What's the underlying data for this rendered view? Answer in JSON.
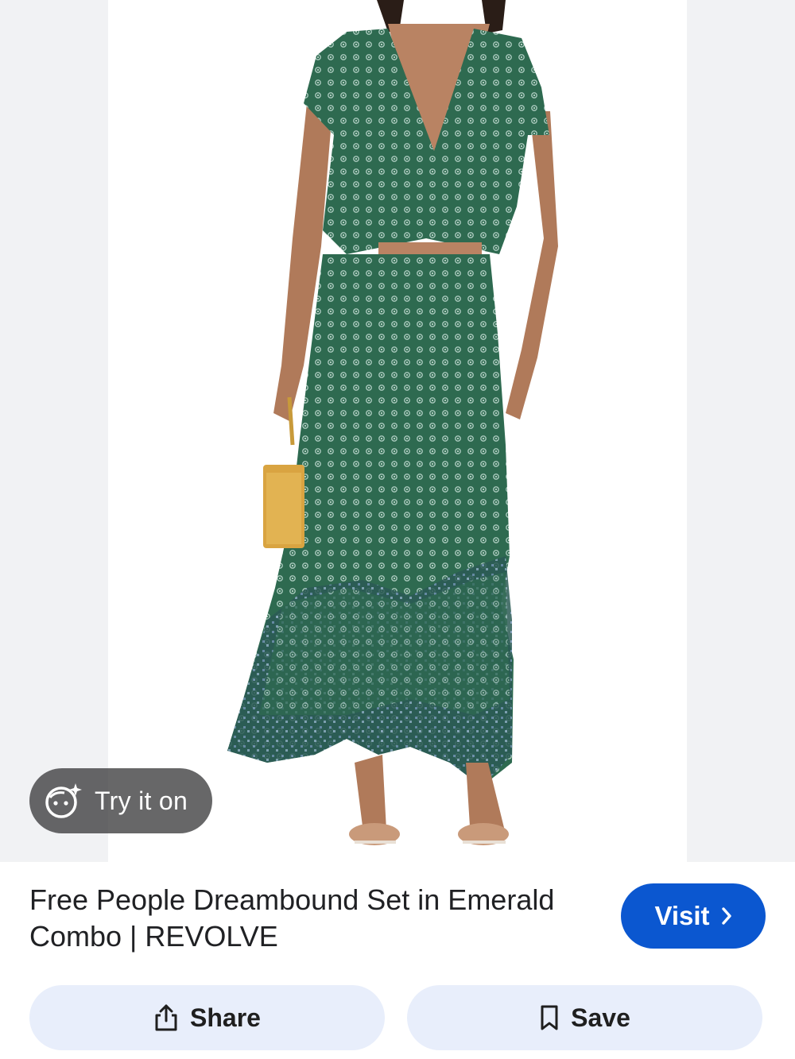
{
  "product": {
    "title": "Free People Dreambound Set in Emerald Combo | REVOLVE",
    "image_alt": "Free People Dreambound Set in Emerald Combo"
  },
  "try_on": {
    "label": "Try it on",
    "icon": "face-sparkle-icon"
  },
  "visit": {
    "label": "Visit",
    "icon": "chevron-right-icon"
  },
  "actions": {
    "share_label": "Share",
    "share_icon": "share-icon",
    "save_label": "Save",
    "save_icon": "bookmark-icon"
  },
  "colors": {
    "visit_button": "#0b57d0",
    "action_button_bg": "#e8eefb",
    "dress_green": "#2f6b52"
  }
}
